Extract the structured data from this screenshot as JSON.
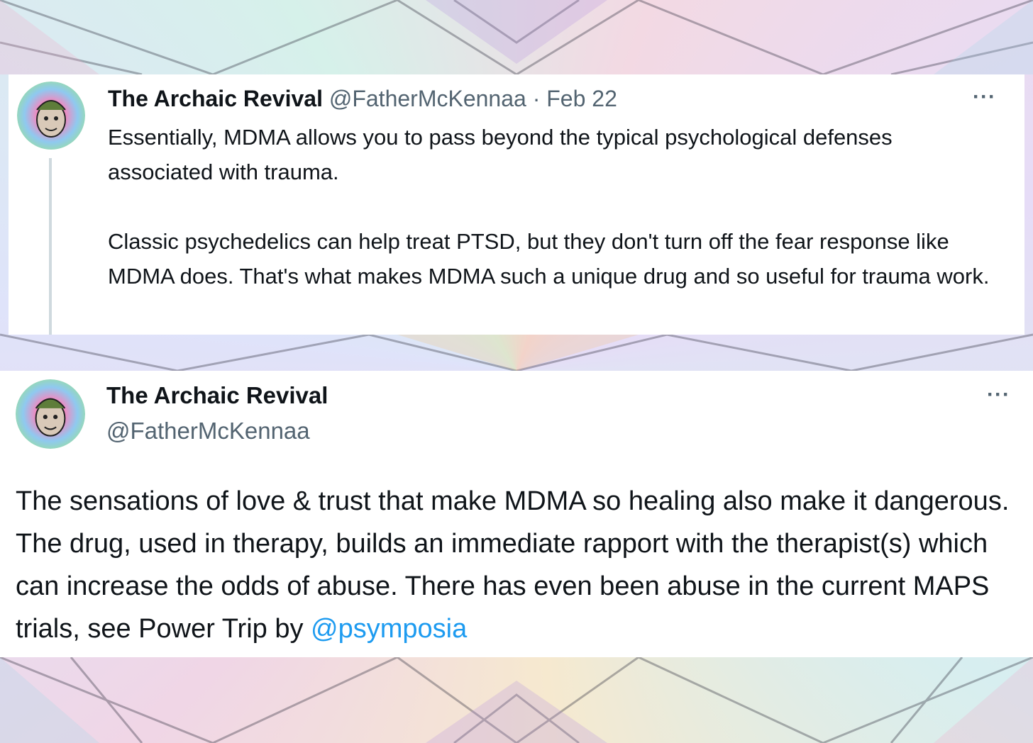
{
  "colors": {
    "text_primary": "#0f1419",
    "text_secondary": "#536471",
    "link": "#1d9bf0",
    "thread_line": "#cfd9de"
  },
  "tweet1": {
    "display_name": "The Archaic Revival",
    "handle": "@FatherMcKennaa",
    "separator": "·",
    "date": "Feb 22",
    "more_icon": "more-horizontal-icon",
    "more_label": "···",
    "paragraphs": [
      "Essentially, MDMA allows you to pass beyond the typical psychological defenses associated with trauma.",
      "Classic psychedelics can help treat PTSD, but they don't turn off the fear response like MDMA does. That's what makes MDMA such a unique drug and so useful for trauma work."
    ]
  },
  "tweet2": {
    "display_name": "The Archaic Revival",
    "handle": "@FatherMcKennaa",
    "more_icon": "more-horizontal-icon",
    "more_label": "···",
    "text": "The sensations of love & trust that make MDMA so healing also make it dangerous. The drug, used in therapy, builds an immediate rapport with the therapist(s) which can increase the odds of abuse. There has even been abuse in the current MAPS trials, see Power Trip by ",
    "mention": "@psymposia"
  }
}
